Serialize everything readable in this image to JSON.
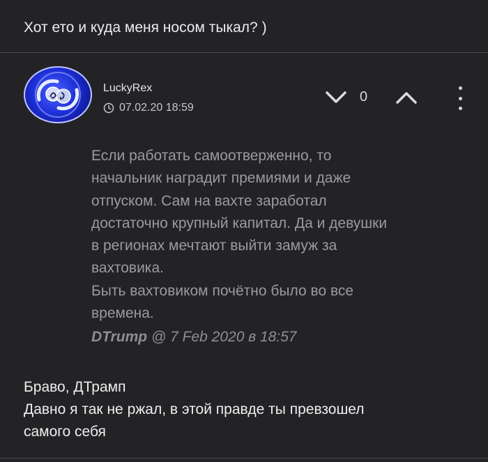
{
  "previous_comment": {
    "text": "Хот ето и куда меня носом тыкал? )"
  },
  "comment": {
    "author": "LuckyRex",
    "date": "07.02.20 18:59",
    "score": "0",
    "quote": {
      "lines": [
        "Если работать самоотверженно, то",
        "начальник наградит премиями и даже",
        "отпуском. Сам на вахте заработал",
        "достаточно крупный капитал. Да и девушки",
        "в регионах мечтают выйти замуж за",
        "вахтовика.",
        "Быть вахтовиком почётно было во все",
        "времена."
      ],
      "author": "DTrump",
      "meta": "@ 7 Feb 2020 в 18:57"
    },
    "body": {
      "lines": [
        "Браво, ДТрамп",
        "Давно я так не ржал, в этой правде ты превзошел",
        "самого себя"
      ]
    }
  },
  "icons": {
    "clock": "clock-icon",
    "vote_down": "chevron-down-icon",
    "vote_up": "chevron-up-icon",
    "more": "more-vertical-icon"
  }
}
